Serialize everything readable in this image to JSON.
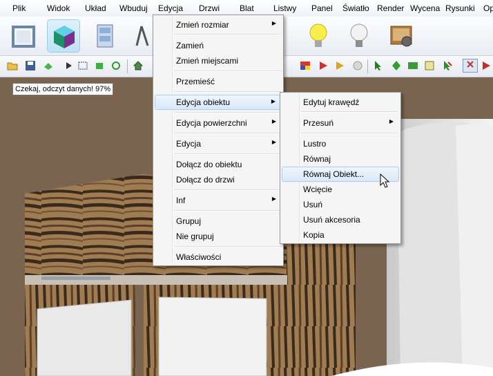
{
  "menubar": {
    "items": [
      "Plik",
      "Widok",
      "Układ",
      "Wbuduj",
      "Edycja",
      "Drzwi",
      "Blat",
      "Listwy",
      "Panel",
      "Światło",
      "Render",
      "Wycena",
      "Rysunki",
      "Op"
    ]
  },
  "status": {
    "tooltip": "Czekaj, odczyt danych! 97%"
  },
  "context_menu": {
    "items": [
      "Zmień rozmiar",
      "Zamień",
      "Zmień miejscami",
      "Przemieść",
      "Edycja obiektu",
      "Edycja powierzchni",
      "Edycja",
      "Dołącz do obiektu",
      "Dołącz do drzwi",
      "Inf",
      "Grupuj",
      "Nie grupuj",
      "Właściwości"
    ]
  },
  "submenu": {
    "items": [
      "Edytuj krawędź",
      "Przesuń",
      "Lustro",
      "Równaj",
      "Równaj Obiekt...",
      "Wcięcie",
      "Usuń",
      "Usuń akcesoria",
      "Kopia"
    ]
  },
  "colors": {
    "highlight": "#d9e8f9",
    "wood_dark": "#3b2a1c",
    "wood_light": "#b08b5f"
  }
}
